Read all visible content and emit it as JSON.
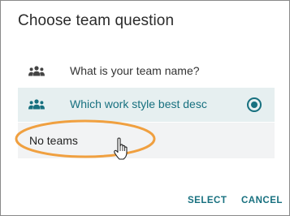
{
  "dialog": {
    "title": "Choose team question",
    "options": [
      {
        "label": "What is your team name?",
        "icon": "team-icon",
        "selected": false
      },
      {
        "label": "Which work style best desc",
        "icon": "team-icon",
        "selected": true
      },
      {
        "label": "No teams",
        "icon": null,
        "selected": false
      }
    ],
    "select_label": "SELECT",
    "cancel_label": "CANCEL"
  },
  "colors": {
    "accent": "#17707f",
    "selected_bg": "#e6eff0",
    "highlight_ring": "#f0a040"
  }
}
